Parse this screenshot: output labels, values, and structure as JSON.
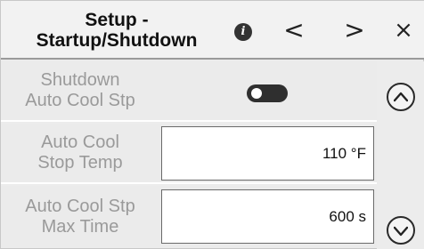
{
  "header": {
    "title": "Setup -\nStartup/Shutdown",
    "info_glyph": "i",
    "prev_glyph": "<",
    "next_glyph": ">",
    "close_glyph": "×"
  },
  "rows": [
    {
      "label": "Shutdown\nAuto Cool Stp",
      "control": "toggle",
      "state": "off"
    },
    {
      "label": "Auto Cool\nStop Temp",
      "control": "input",
      "value": "110 °F"
    },
    {
      "label": "Auto Cool Stp\nMax Time",
      "control": "input",
      "value": "600 s"
    }
  ],
  "scroll": {
    "up_icon": "chevron-up-icon",
    "down_icon": "chevron-down-icon"
  },
  "colors": {
    "label_text": "#9a9a9a",
    "toggle_track": "#2f2f2f",
    "row_bg": "#ebebeb"
  }
}
